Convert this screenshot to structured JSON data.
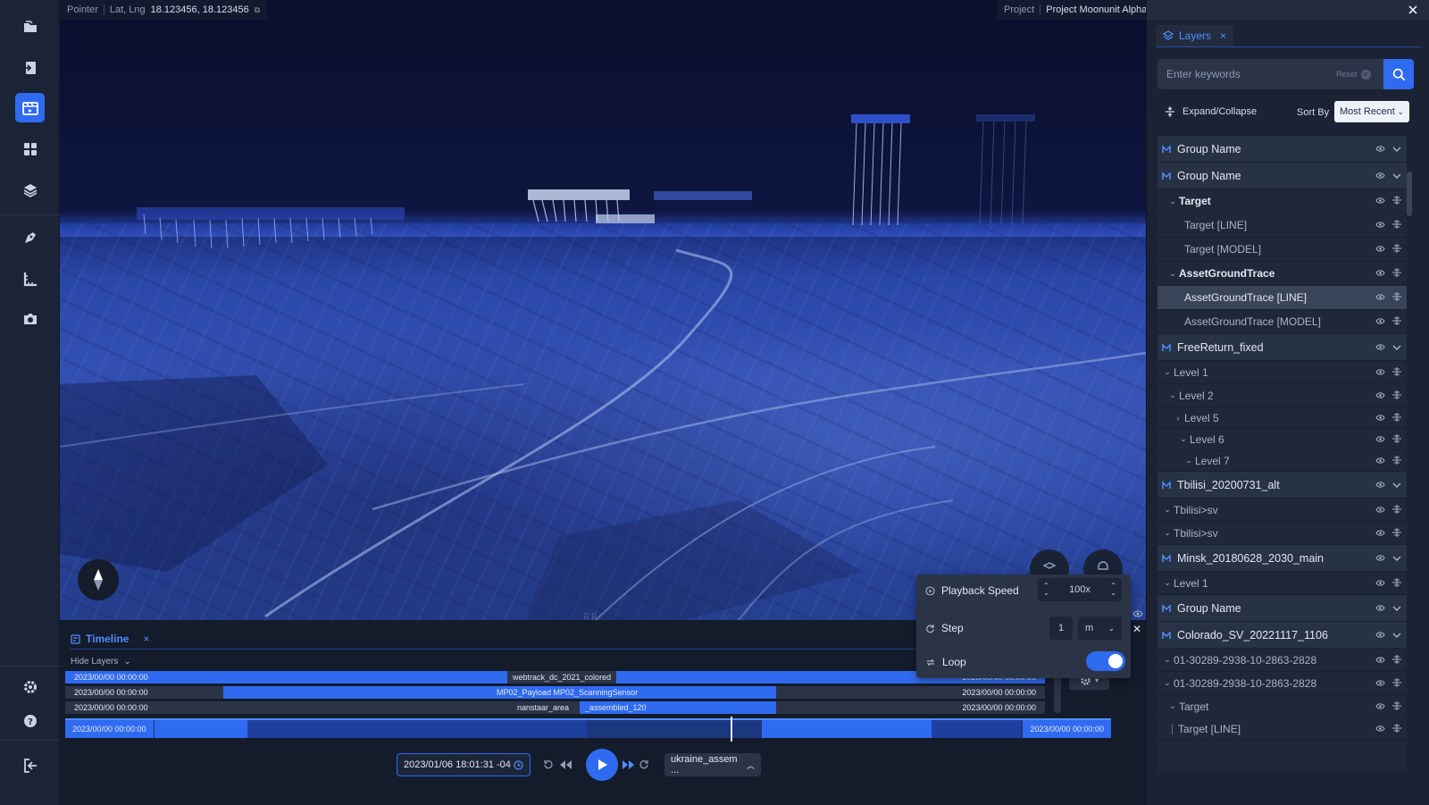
{
  "rail": {
    "items": [
      {
        "name": "files-icon"
      },
      {
        "name": "import-icon"
      },
      {
        "name": "scene-icon",
        "active": true
      },
      {
        "name": "dashboard-icon"
      },
      {
        "name": "layers-icon"
      },
      {
        "name": "draw-icon"
      },
      {
        "name": "measure-icon"
      },
      {
        "name": "camera-icon"
      }
    ],
    "bottom": [
      {
        "name": "settings-icon"
      },
      {
        "name": "help-icon"
      },
      {
        "name": "logout-icon"
      }
    ]
  },
  "map": {
    "pointer_label": "Pointer",
    "latlng_label": "Lat, Lng",
    "latlng_value": "18.123456, 18.123456",
    "project_label": "Project",
    "project_value": "Project Moonunit Alpha"
  },
  "layers_panel": {
    "tab_label": "Layers",
    "search_placeholder": "Enter keywords",
    "reset_label": "Reset",
    "expand_label": "Expand/Collapse",
    "sort_by_label": "Sort By",
    "sort_value": "Most Recent",
    "rows": [
      {
        "label": "Group Name",
        "kind": "group"
      },
      {
        "label": "Group Name",
        "kind": "group"
      },
      {
        "label": "Target",
        "kind": "folder-bold",
        "indent": 1
      },
      {
        "label": "Target [LINE]",
        "kind": "leaf",
        "indent": 2
      },
      {
        "label": "Target [MODEL]",
        "kind": "leaf",
        "indent": 2
      },
      {
        "label": "AssetGroundTrace",
        "kind": "folder-bold",
        "indent": 1
      },
      {
        "label": "AssetGroundTrace [LINE]",
        "kind": "leaf-selected",
        "indent": 2
      },
      {
        "label": "AssetGroundTrace [MODEL]",
        "kind": "leaf",
        "indent": 2
      },
      {
        "label": "FreeReturn_fixed",
        "kind": "group"
      },
      {
        "label": "Level 1",
        "kind": "folder",
        "indent": 0
      },
      {
        "label": "Level 2",
        "kind": "folder",
        "indent": 1
      },
      {
        "label": "Level 5",
        "kind": "folder-collapsed",
        "indent": 2
      },
      {
        "label": "Level 6",
        "kind": "folder",
        "indent": 3
      },
      {
        "label": "Level 7",
        "kind": "folder",
        "indent": 4
      },
      {
        "label": "Tbilisi_20200731_alt",
        "kind": "group"
      },
      {
        "label": "Tbilisi>sv",
        "kind": "folder",
        "indent": 0
      },
      {
        "label": "Tbilisi>sv",
        "kind": "folder",
        "indent": 0
      },
      {
        "label": "Minsk_20180628_2030_main",
        "kind": "group"
      },
      {
        "label": "Level 1",
        "kind": "folder",
        "indent": 0
      },
      {
        "label": "Group Name",
        "kind": "group"
      },
      {
        "label": "Colorado_SV_20221117_1106",
        "kind": "group"
      },
      {
        "label": "01-30289-2938-10-2863-2828",
        "kind": "folder",
        "indent": 0
      },
      {
        "label": "01-30289-2938-10-2863-2828",
        "kind": "folder",
        "indent": 0
      },
      {
        "label": "Target",
        "kind": "folder",
        "indent": 1
      },
      {
        "label": "Target [LINE]",
        "kind": "leaf-line",
        "indent": 1
      }
    ]
  },
  "timeline": {
    "tab_label": "Timeline",
    "hide_layers_label": "Hide Layers",
    "tracks": [
      {
        "start": "2023/00/00  00:00:00",
        "label": "webtrack_dc_2021_colored",
        "end": "2023/00/00  00:00:00"
      },
      {
        "start": "2023/00/00  00:00:00",
        "label": "MP02_Payload MP02_ScanningSensor",
        "end": "2023/00/00  00:00:00"
      },
      {
        "start": "2023/00/00  00:00:00",
        "label": "nanstaar_area",
        "label2": "_assembled_120",
        "end": "2023/00/00  00:00:00"
      }
    ],
    "main_start": "2023/00/00  00:00:00",
    "main_end": "2023/00/00  00:00:00",
    "current_time": "2023/01/06  18:01:31  -04",
    "asset_select": "ukraine_assem ...",
    "playback_position": 0.63
  },
  "playback": {
    "speed_label": "Playback Speed",
    "speed_value": "100x",
    "step_label": "Step",
    "step_value": "1",
    "step_unit": "m",
    "loop_label": "Loop",
    "loop_on": true
  }
}
